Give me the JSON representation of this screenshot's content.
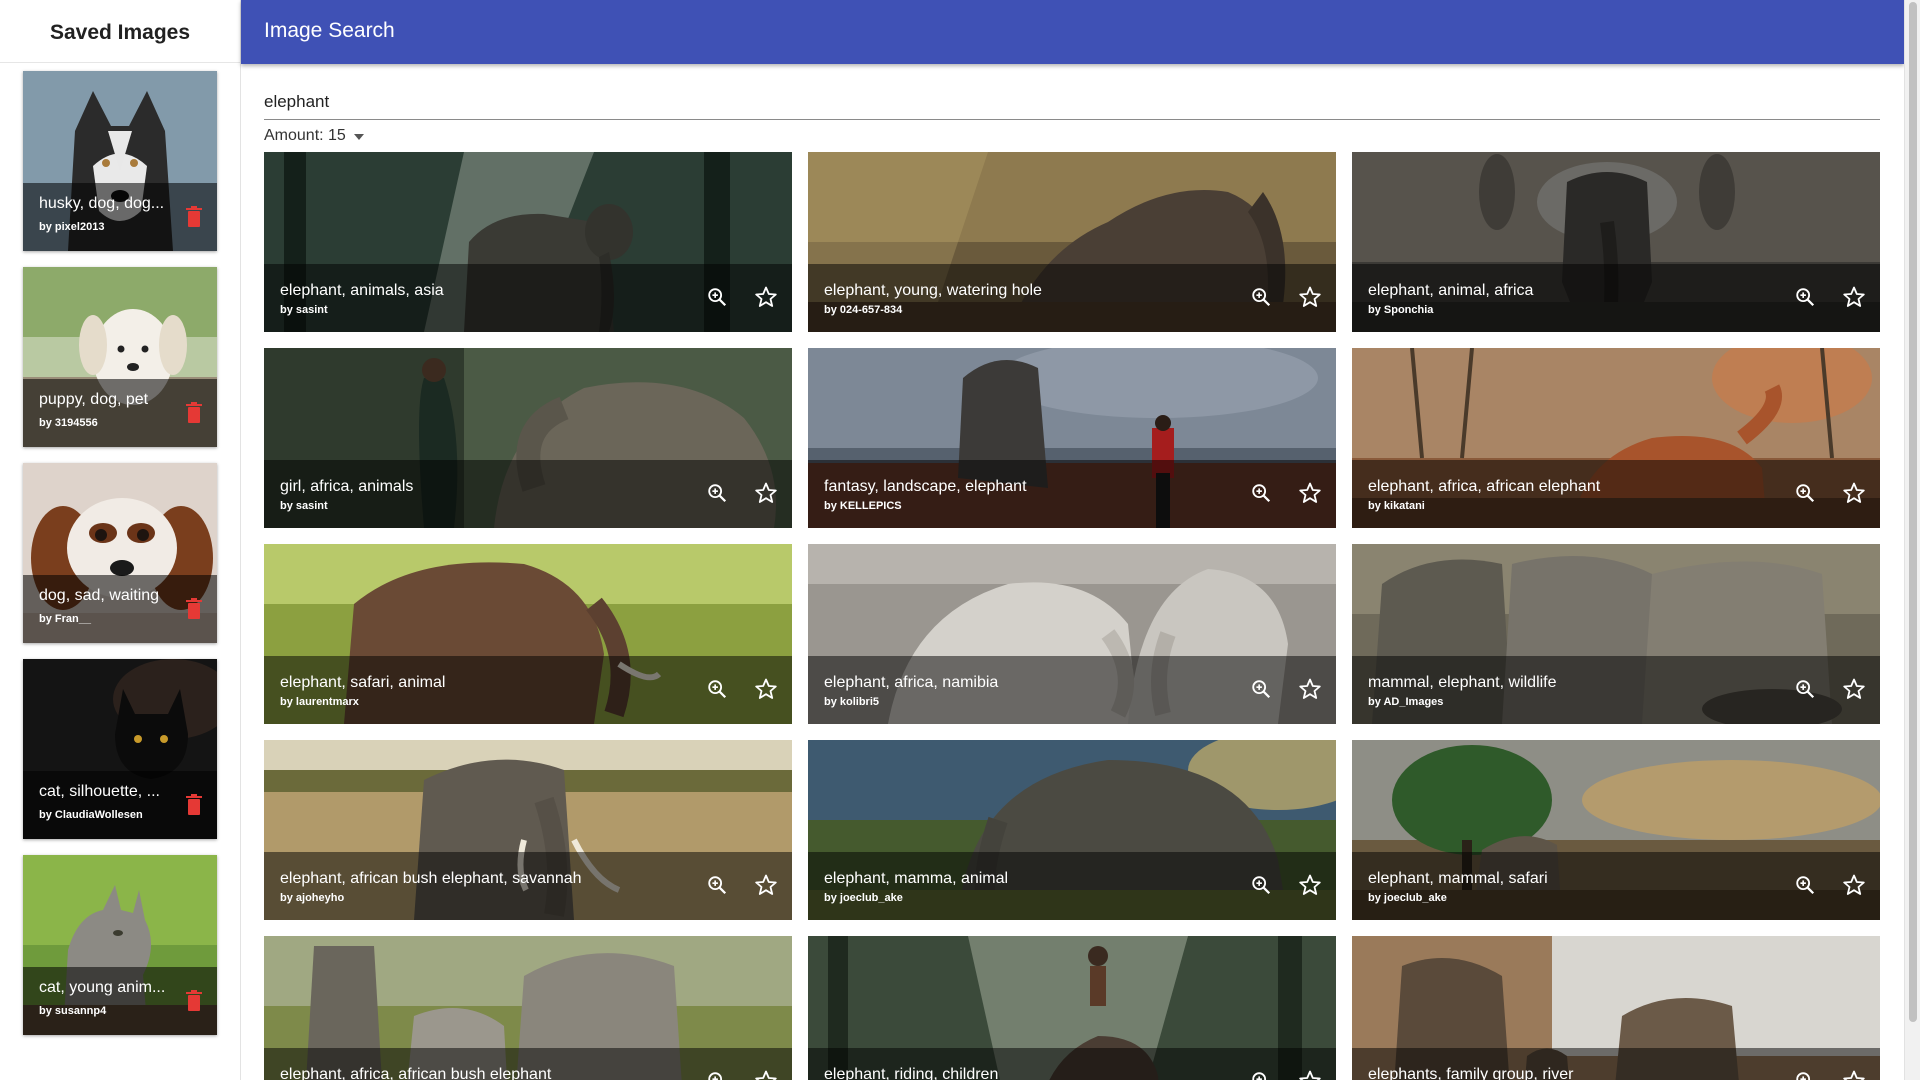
{
  "sidebar": {
    "title": "Saved Images",
    "items": [
      {
        "tags": "husky, dog, dog...",
        "author": "by pixel2013"
      },
      {
        "tags": "puppy, dog, pet",
        "author": "by 3194556"
      },
      {
        "tags": "dog, sad, waiting",
        "author": "by Fran__"
      },
      {
        "tags": "cat, silhouette, ...",
        "author": "by ClaudiaWollesen"
      },
      {
        "tags": "cat, young anim...",
        "author": "by susannp4"
      }
    ]
  },
  "header": {
    "title": "Image Search"
  },
  "search": {
    "value": "elephant"
  },
  "amount": {
    "label": "Amount: 15"
  },
  "results": [
    {
      "tags": "elephant, animals, asia",
      "author": "by sasint"
    },
    {
      "tags": "elephant, young, watering hole",
      "author": "by 024-657-834"
    },
    {
      "tags": "elephant, animal, africa",
      "author": "by Sponchia"
    },
    {
      "tags": "girl, africa, animals",
      "author": "by sasint"
    },
    {
      "tags": "fantasy, landscape, elephant",
      "author": "by KELLEPICS"
    },
    {
      "tags": "elephant, africa, african elephant",
      "author": "by kikatani"
    },
    {
      "tags": "elephant, safari, animal",
      "author": "by laurentmarx"
    },
    {
      "tags": "elephant, africa, namibia",
      "author": "by kolibri5"
    },
    {
      "tags": "mammal, elephant, wildlife",
      "author": "by AD_Images"
    },
    {
      "tags": "elephant, african bush elephant, savannah",
      "author": "by ajoheyho"
    },
    {
      "tags": "elephant, mamma, animal",
      "author": "by joeclub_ake"
    },
    {
      "tags": "elephant, mammal, safari",
      "author": "by joeclub_ake"
    },
    {
      "tags": "elephant, africa, african bush elephant",
      "author": ""
    },
    {
      "tags": "elephant, riding, children",
      "author": ""
    },
    {
      "tags": "elephants, family group, river",
      "author": ""
    }
  ],
  "colors": {
    "appbar": "#3f51b5",
    "delete": "#e53935"
  }
}
